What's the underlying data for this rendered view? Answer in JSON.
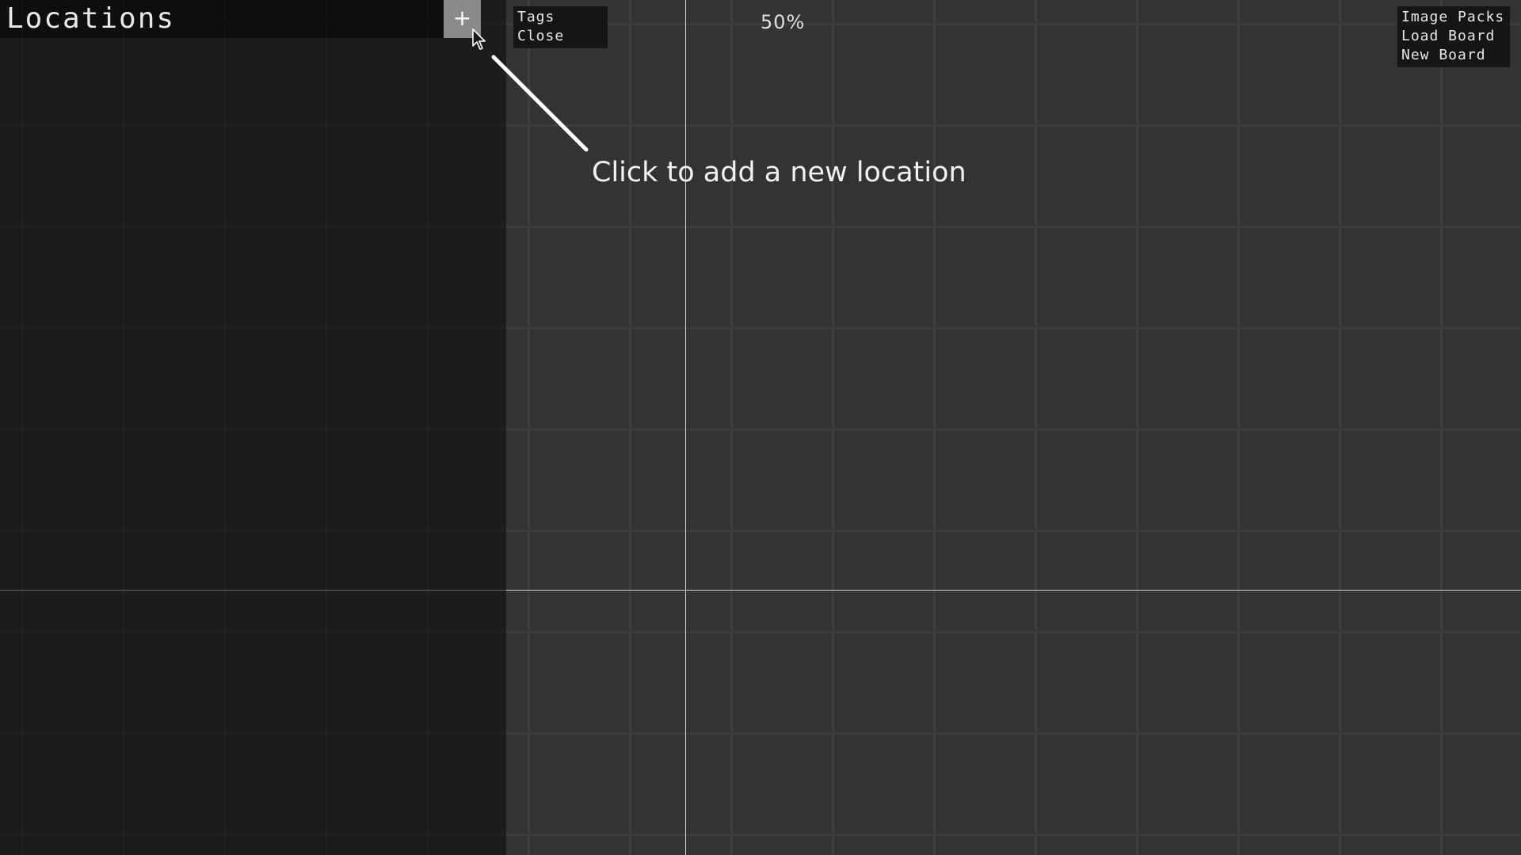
{
  "sidebar": {
    "title": "Locations",
    "add_button_label": "+"
  },
  "left_menu": {
    "items": [
      "Tags",
      "Close"
    ]
  },
  "zoom": {
    "label": "50%"
  },
  "right_menu": {
    "items": [
      "Image Packs",
      "Load Board",
      "New Board"
    ]
  },
  "hint": {
    "text": "Click to add a new location"
  },
  "colors": {
    "canvas_background": "#333333",
    "grid_line": "#3d3d3d",
    "axis_line": "#cfcfcf",
    "sidebar_overlay": "#1b1b1b",
    "add_button": "#8a8a8a",
    "menu_background": "#151515",
    "text": "#e8e8e8"
  },
  "icons": {
    "add_button_icon": "plus-icon",
    "cursor_icon": "mouse-pointer-icon"
  }
}
